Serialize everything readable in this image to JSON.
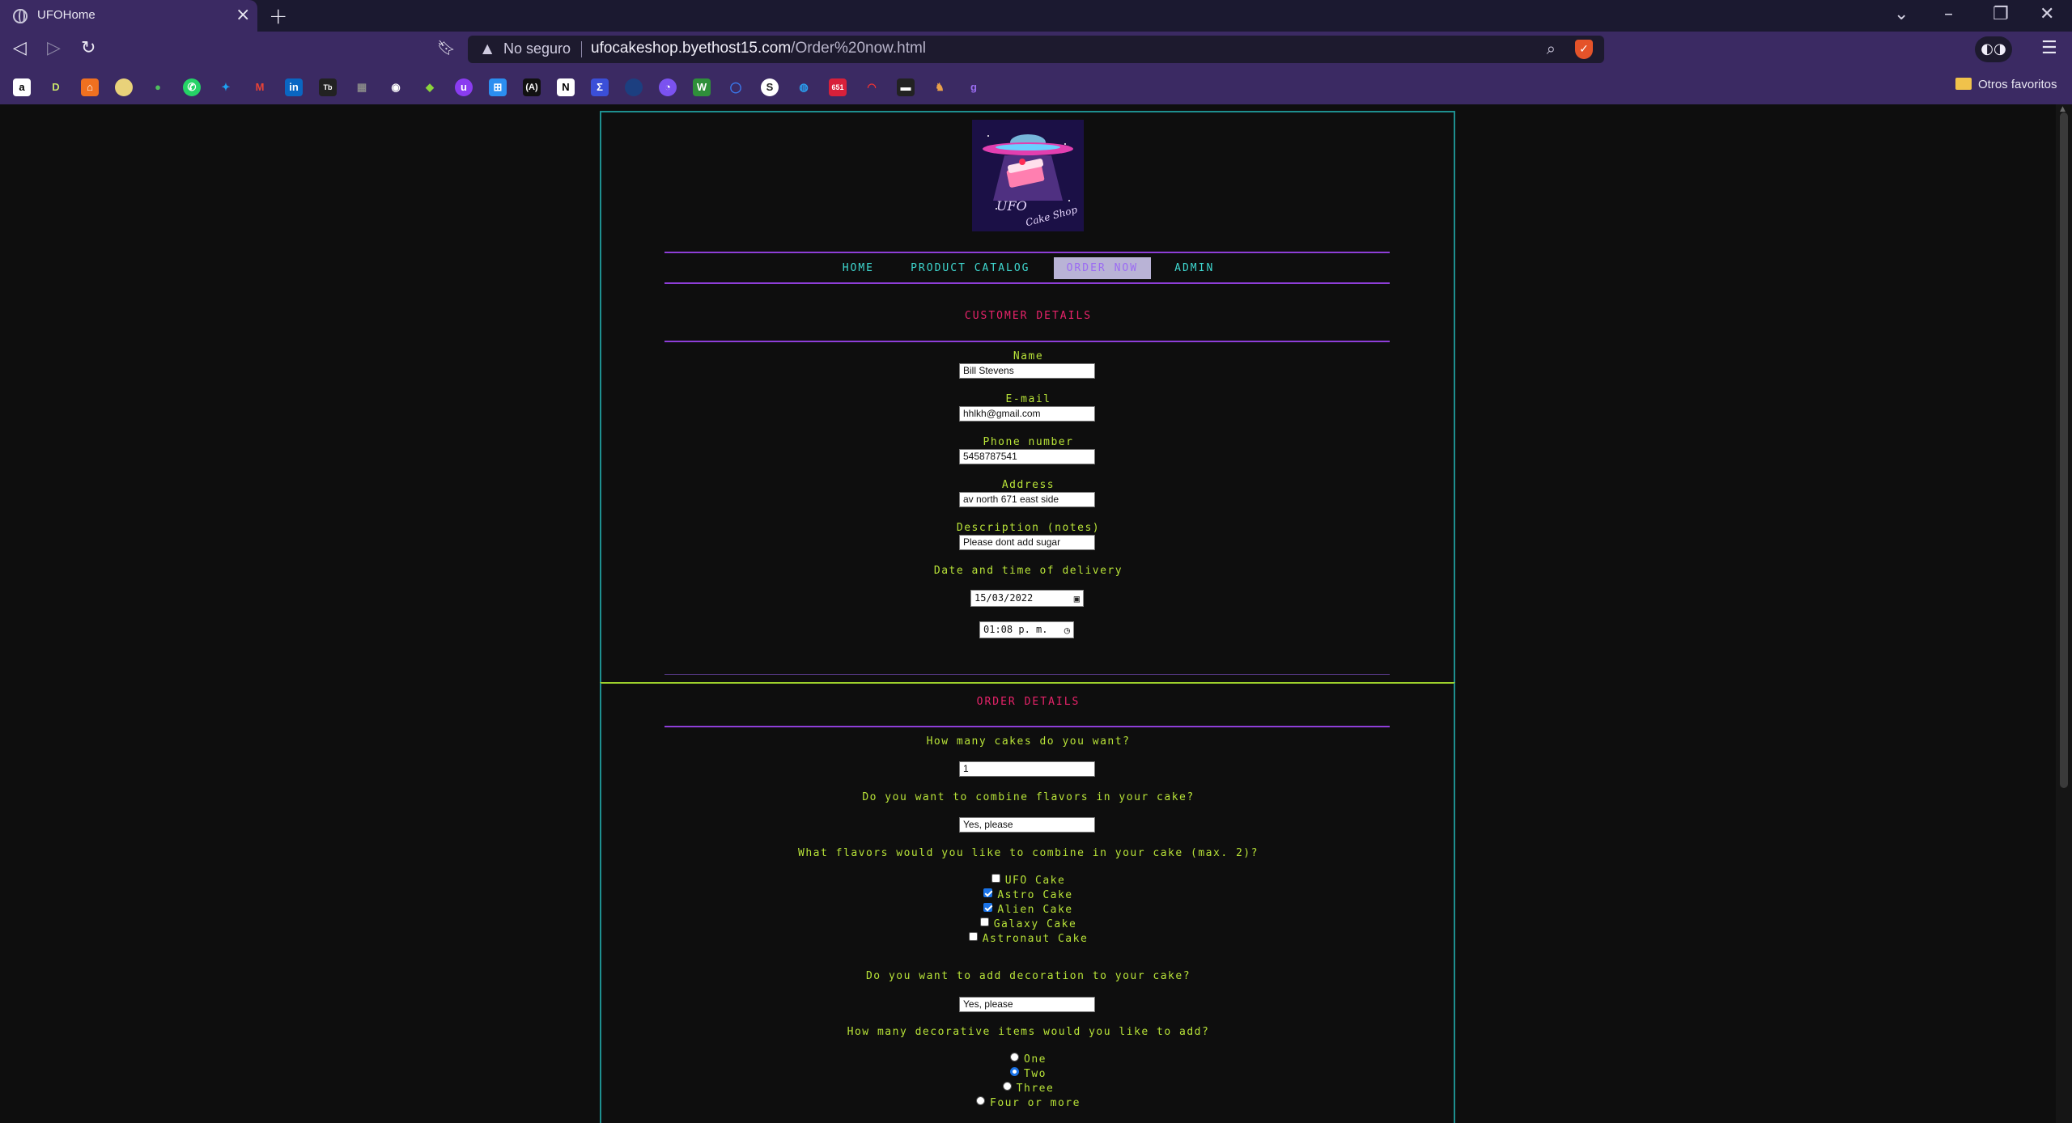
{
  "browser": {
    "tab_title": "UFOHome",
    "insecure_label": "No seguro",
    "url_host": "ufocakeshop.byethost15.com",
    "url_path": "/Order%20now.html",
    "bookmarks_folder": "Otros favoritos"
  },
  "nav": {
    "home": "HOME",
    "catalog": "PRODUCT CATALOG",
    "order": "ORDER NOW",
    "admin": "ADMIN"
  },
  "customer": {
    "title": "CUSTOMER DETAILS",
    "name_label": "Name",
    "name_value": "Bill Stevens",
    "email_label": "E-mail",
    "email_value": "hhlkh@gmail.com",
    "phone_label": "Phone number",
    "phone_value": "5458787541",
    "address_label": "Address",
    "address_value": "av north 671 east side",
    "notes_label": "Description (notes)",
    "notes_value": "Please dont add sugar",
    "delivery_label": "Date and time of delivery",
    "date_value": "15/03/2022",
    "time_value": "01:08 p. m."
  },
  "order": {
    "title": "ORDER DETAILS",
    "qty_label": "How many cakes do you want?",
    "qty_value": "1",
    "combine_label": "Do you want to combine flavors in your cake?",
    "combine_value": "Yes, please",
    "flavors_label": "What flavors would you like to combine in your cake (max. 2)?",
    "flavors": [
      {
        "label": "UFO Cake",
        "checked": false
      },
      {
        "label": "Astro Cake",
        "checked": true
      },
      {
        "label": "Alien Cake",
        "checked": true
      },
      {
        "label": "Galaxy Cake",
        "checked": false
      },
      {
        "label": "Astronaut Cake",
        "checked": false
      }
    ],
    "decoration_label": "Do you want to add decoration to your cake?",
    "decoration_value": "Yes, please",
    "items_label": "How many decorative items would you like to add?",
    "items": [
      {
        "label": "One",
        "selected": false
      },
      {
        "label": "Two",
        "selected": true
      },
      {
        "label": "Three",
        "selected": false
      },
      {
        "label": "Four or more",
        "selected": false
      }
    ]
  },
  "colors": {
    "accent_cyan": "#3fd8d0",
    "accent_lime": "#b8e338",
    "accent_pink": "#e8236a",
    "accent_purple": "#8e3ed8",
    "chrome": "#3b2a63"
  }
}
